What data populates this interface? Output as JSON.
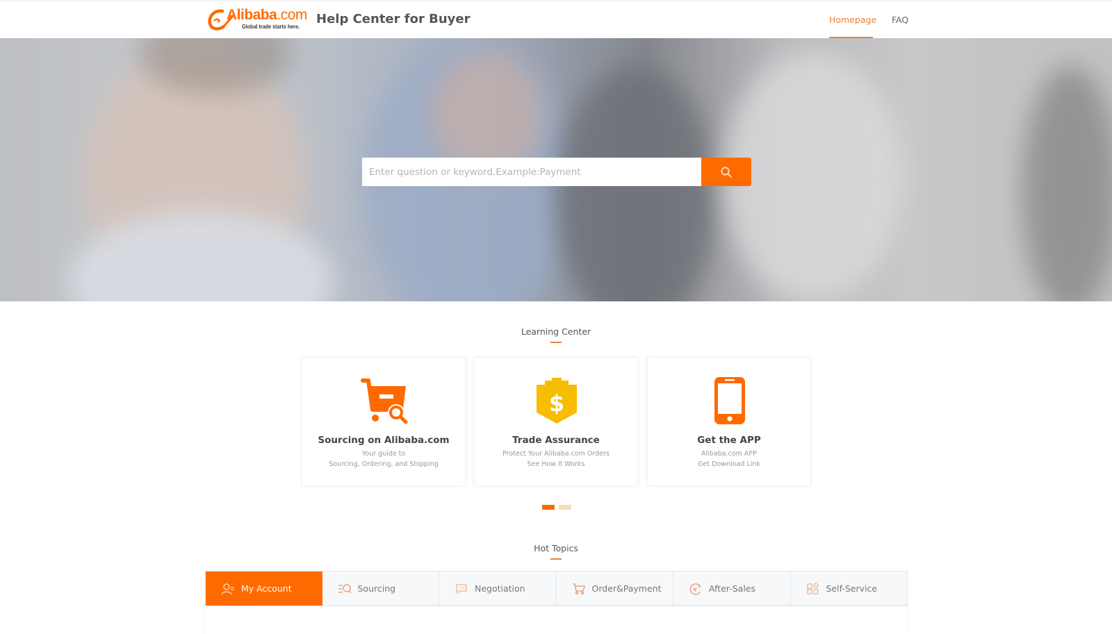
{
  "header": {
    "logo_brand": "Alibaba",
    "logo_suffix": ".com",
    "logo_tagline": "Global trade starts here.",
    "title": "Help Center for Buyer",
    "nav": [
      {
        "label": "Homepage",
        "active": true
      },
      {
        "label": "FAQ",
        "active": false
      }
    ]
  },
  "search": {
    "placeholder": "Enter question or keyword.Example:Payment",
    "value": "",
    "button_icon": "search-icon"
  },
  "learning_center": {
    "title": "Learning Center",
    "cards": [
      {
        "icon": "cart-search-icon",
        "title": "Sourcing on Alibaba.com",
        "lines": [
          "Your guide to",
          "Sourcing, Ordering, and Shipping"
        ]
      },
      {
        "icon": "trade-assurance-shield-icon",
        "title": "Trade Assurance",
        "lines": [
          "Protect Your Alibaba.com Orders",
          "See How It Works"
        ]
      },
      {
        "icon": "mobile-phone-icon",
        "title": "Get the APP",
        "lines": [
          "Alibaba.com APP",
          "Get Download Link"
        ]
      }
    ],
    "carousel": {
      "pages": 2,
      "active_page": 1
    }
  },
  "hot_topics": {
    "title": "Hot Topics",
    "tabs": [
      {
        "label": "My Account",
        "icon": "user-icon",
        "active": true
      },
      {
        "label": "Sourcing",
        "icon": "sourcing-search-icon",
        "active": false
      },
      {
        "label": "Negotiation",
        "icon": "chat-bubble-icon",
        "active": false
      },
      {
        "label": "Order&Payment",
        "icon": "cart-icon",
        "active": false
      },
      {
        "label": "After-Sales",
        "icon": "refund-yuan-icon",
        "active": false
      },
      {
        "label": "Self-Service",
        "icon": "grid-apps-icon",
        "active": false
      }
    ]
  },
  "colors": {
    "accent": "#ff6a00",
    "nav_active": "#e8813a",
    "trade_assurance": "#f7bd00",
    "dot_inactive": "#f8dcbf"
  }
}
